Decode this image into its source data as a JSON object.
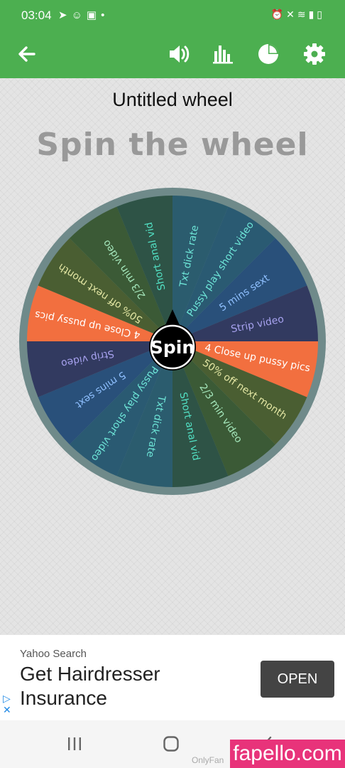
{
  "status_bar": {
    "time": "03:04",
    "left_icons": [
      "telegram-icon",
      "snapchat-icon",
      "gallery-icon",
      "dot-icon"
    ],
    "right_icons": [
      "alarm-icon",
      "mute-icon",
      "wifi-icon",
      "signal-icon",
      "battery-icon"
    ]
  },
  "app_bar": {
    "color": "#4caf50",
    "icons": [
      "back-arrow-icon",
      "volume-icon",
      "bar-chart-icon",
      "pie-chart-icon",
      "gear-icon"
    ]
  },
  "wheel_title": "Untitled wheel",
  "headline": "Spin the wheel",
  "spin_button": "Spin",
  "wheel": {
    "slices": [
      {
        "label": "Txt dick rate",
        "color": "#2b5c6e",
        "text_color": "#6ee6d8"
      },
      {
        "label": "Pussy play short video",
        "color": "#2a5a72",
        "text_color": "#6ee6d8"
      },
      {
        "label": "5 mins sext",
        "color": "#29507a",
        "text_color": "#8fc0ff"
      },
      {
        "label": "Strip video",
        "color": "#323a60",
        "text_color": "#a7a2ef"
      },
      {
        "label": "4 Close up pussy pics",
        "color": "#f26f3f",
        "text_color": "#ffffff"
      },
      {
        "label": "50% off next month",
        "color": "#4a5e32",
        "text_color": "#e4e7a4"
      },
      {
        "label": "2/3 min video",
        "color": "#3b5a36",
        "text_color": "#a5e7bc"
      },
      {
        "label": "Short anal vid",
        "color": "#2e5346",
        "text_color": "#52e0c4"
      },
      {
        "label": "Txt dick rate",
        "color": "#2b5c6e",
        "text_color": "#6ee6d8"
      },
      {
        "label": "Pussy play short video",
        "color": "#2a5a72",
        "text_color": "#6ee6d8"
      },
      {
        "label": "5 mins sext",
        "color": "#29507a",
        "text_color": "#8fc0ff"
      },
      {
        "label": "Strip video",
        "color": "#323a60",
        "text_color": "#a7a2ef"
      },
      {
        "label": "4 Close up pussy pics",
        "color": "#f26f3f",
        "text_color": "#ffffff"
      },
      {
        "label": "50% off next month",
        "color": "#4a5e32",
        "text_color": "#e4e7a4"
      },
      {
        "label": "2/3 min video",
        "color": "#3b5a36",
        "text_color": "#a5e7bc"
      },
      {
        "label": "Short anal vid",
        "color": "#2e5346",
        "text_color": "#52e0c4"
      }
    ]
  },
  "ad": {
    "source": "Yahoo Search",
    "headline": "Get Hairdresser Insurance",
    "button": "OPEN"
  },
  "nav_bar": {
    "icons": [
      "recent-apps-icon",
      "home-icon",
      "back-icon"
    ]
  },
  "watermark": {
    "ghost_text": "OnlyFan",
    "text": "fapello.com"
  }
}
